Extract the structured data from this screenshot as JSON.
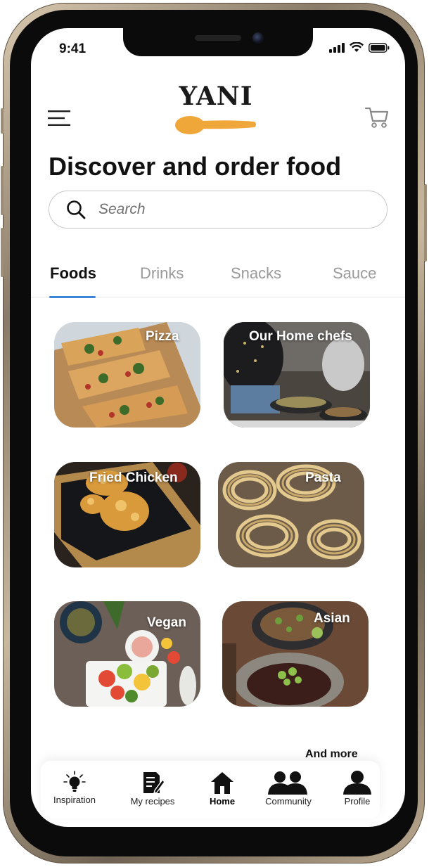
{
  "status_bar": {
    "time": "9:41"
  },
  "header": {
    "logo_text": "YANI",
    "logo_color": "#EFA73A"
  },
  "page_title": "Discover and order food",
  "search": {
    "placeholder": "Search"
  },
  "tabs": [
    {
      "label": "Foods",
      "active": true
    },
    {
      "label": "Drinks",
      "active": false
    },
    {
      "label": "Snacks",
      "active": false
    },
    {
      "label": "Sauce",
      "active": false
    }
  ],
  "accent_color": "#3A86D9",
  "categories": [
    {
      "label": "Pizza"
    },
    {
      "label": "Our Home chefs"
    },
    {
      "label": "Fried Chicken"
    },
    {
      "label": "Pasta"
    },
    {
      "label": "Vegan"
    },
    {
      "label": "Asian"
    }
  ],
  "more_link": "And more",
  "bottom_nav": [
    {
      "label": "Inspiration",
      "icon": "lightbulb-icon"
    },
    {
      "label": "My recipes",
      "icon": "recipe-note-icon"
    },
    {
      "label": "Home",
      "icon": "home-icon",
      "active": true
    },
    {
      "label": "Community",
      "icon": "community-icon"
    },
    {
      "label": "Profile",
      "icon": "profile-icon"
    }
  ]
}
